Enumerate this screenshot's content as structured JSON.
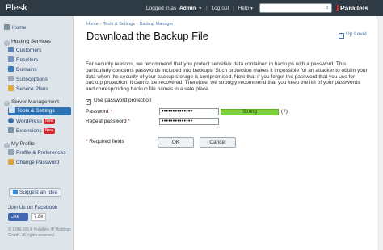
{
  "topbar": {
    "brand": "Plesk",
    "logged_in_as": "Logged in as",
    "user": "Admin",
    "logout": "Log out",
    "help": "Help",
    "search_placeholder": "",
    "vendor": "Parallels"
  },
  "sidebar": {
    "sections": [
      {
        "label": "Home"
      },
      {
        "label": "Hosting Services",
        "items": [
          "Customers",
          "Resellers",
          "Domains",
          "Subscriptions",
          "Service Plans"
        ]
      },
      {
        "label": "Server Management",
        "items": [
          "Tools & Settings",
          "WordPress",
          "Extensions"
        ],
        "badges": [
          "New",
          "New"
        ]
      },
      {
        "label": "My Profile",
        "items": [
          "Profile & Preferences",
          "Change Password"
        ]
      }
    ],
    "suggest": "Suggest an Idea",
    "facebook": "Join Us on Facebook",
    "like": "Like",
    "like_count": "7.8k",
    "copyright": "© 1999-2014, Parallels IP Holdings GmbH. All rights reserved."
  },
  "main": {
    "breadcrumbs": [
      "Home",
      "Tools & Settings",
      "Backup Manager"
    ],
    "title": "Download the Backup File",
    "up_level": "Up Level",
    "description": "For security reasons, we recommend that you protect sensitive data contained in backups with a password. This particularly concerns passwords included into backups. Such protection makes it impossible for an attacker to obtain your data when the security of your backup storage is compromised. Note that if you forget the password that you use for backup protection, it cannot be recovered. Therefore, we strongly recommend that you keep the list of your passwords and corresponding backup file names in a safe place.",
    "use_password_label": "Use password protection",
    "password_label": "Password",
    "password_value": "••••••••••••••",
    "strength": "Strong",
    "hint": "(?)",
    "repeat_label": "Repeat password",
    "repeat_value": "••••••••••••••",
    "required_note": "Required fields",
    "ok": "OK",
    "cancel": "Cancel"
  },
  "colors": {
    "topbar": "#2e3b45",
    "sidebar": "#dde4ea",
    "active": "#2f72b2",
    "strength": "#7ed03c",
    "badge": "#d3262b"
  }
}
